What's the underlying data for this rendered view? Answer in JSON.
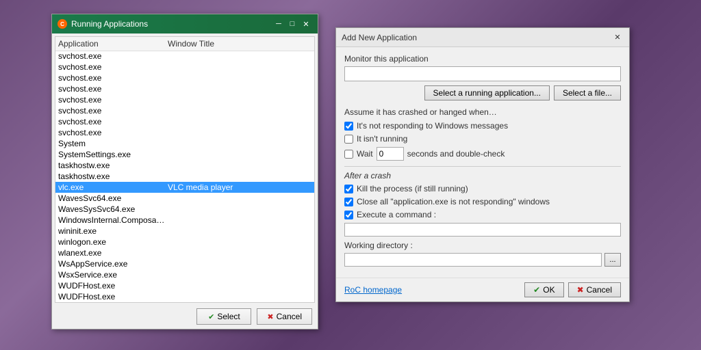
{
  "running_dialog": {
    "title": "Running Applications",
    "icon": "C",
    "columns": {
      "app": "Application",
      "window": "Window Title"
    },
    "items": [
      {
        "app": "svchost.exe",
        "title": "",
        "selected": false
      },
      {
        "app": "svchost.exe",
        "title": "",
        "selected": false
      },
      {
        "app": "svchost.exe",
        "title": "",
        "selected": false
      },
      {
        "app": "svchost.exe",
        "title": "",
        "selected": false
      },
      {
        "app": "svchost.exe",
        "title": "",
        "selected": false
      },
      {
        "app": "svchost.exe",
        "title": "",
        "selected": false
      },
      {
        "app": "svchost.exe",
        "title": "",
        "selected": false
      },
      {
        "app": "svchost.exe",
        "title": "",
        "selected": false
      },
      {
        "app": "svchost.exe",
        "title": "",
        "selected": false
      },
      {
        "app": "System",
        "title": "",
        "selected": false
      },
      {
        "app": "SystemSettings.exe",
        "title": "",
        "selected": false
      },
      {
        "app": "taskhostw.exe",
        "title": "",
        "selected": false
      },
      {
        "app": "taskhostw.exe",
        "title": "",
        "selected": false
      },
      {
        "app": "vlc.exe",
        "title": "VLC media player",
        "selected": true
      },
      {
        "app": "WavesSvc64.exe",
        "title": "",
        "selected": false
      },
      {
        "app": "WavesSysSvc64.exe",
        "title": "",
        "selected": false
      },
      {
        "app": "WindowsInternal.ComposableShell.E...",
        "title": "",
        "selected": false
      },
      {
        "app": "wininit.exe",
        "title": "",
        "selected": false
      },
      {
        "app": "winlogon.exe",
        "title": "",
        "selected": false
      },
      {
        "app": "wlanext.exe",
        "title": "",
        "selected": false
      },
      {
        "app": "WsAppService.exe",
        "title": "",
        "selected": false
      },
      {
        "app": "WsxService.exe",
        "title": "",
        "selected": false
      },
      {
        "app": "WUDFHost.exe",
        "title": "",
        "selected": false
      },
      {
        "app": "WUDFHost.exe",
        "title": "",
        "selected": false
      }
    ],
    "buttons": {
      "select": "Select",
      "cancel": "Cancel"
    }
  },
  "add_dialog": {
    "title": "Add New Application",
    "monitor_label": "Monitor this application",
    "monitor_input_placeholder": "",
    "select_running_btn": "Select a running application...",
    "select_file_btn": "Select a file...",
    "assume_label": "Assume it has crashed or hanged when…",
    "checkboxes": {
      "not_responding": {
        "label": "It's not responding to Windows messages",
        "checked": true
      },
      "not_running": {
        "label": "It isn't running",
        "checked": false
      },
      "wait": {
        "label": "Wait",
        "checked": false,
        "value": "0",
        "suffix": "seconds and double-check"
      }
    },
    "after_crash_label": "After a crash",
    "after_crash_items": {
      "kill_process": {
        "label": "Kill the process (if still running)",
        "checked": true
      },
      "close_windows": {
        "label": "Close all \"application.exe is not responding\" windows",
        "checked": true
      },
      "execute": {
        "label": "Execute a command :",
        "checked": true,
        "value": ""
      }
    },
    "working_dir_label": "Working directory :",
    "working_dir_value": "",
    "browse_btn": "...",
    "roc_link": "RoC homepage",
    "ok_btn": "OK",
    "cancel_btn": "Cancel",
    "titlebar_controls": {
      "minimize": "─",
      "maximize": "□",
      "close": "✕"
    }
  }
}
